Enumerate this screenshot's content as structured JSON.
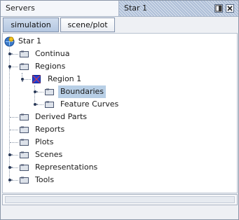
{
  "window": {
    "servers_tab": "Servers",
    "active_tab": "Star 1",
    "restore_icon": "restore-icon",
    "close_icon": "close-icon"
  },
  "tabs": {
    "simulation": "simulation",
    "scene_plot": "scene/plot"
  },
  "tree": {
    "root": "Star 1",
    "items": {
      "continua": "Continua",
      "regions": "Regions",
      "region1": "Region 1",
      "boundaries": "Boundaries",
      "feature_curves": "Feature Curves",
      "derived_parts": "Derived Parts",
      "reports": "Reports",
      "plots": "Plots",
      "scenes": "Scenes",
      "representations": "Representations",
      "tools": "Tools"
    },
    "selected": "Boundaries"
  },
  "colors": {
    "accent": "#b8cfe6",
    "tab_active": "#b4c7e1",
    "border": "#8a96a8"
  }
}
